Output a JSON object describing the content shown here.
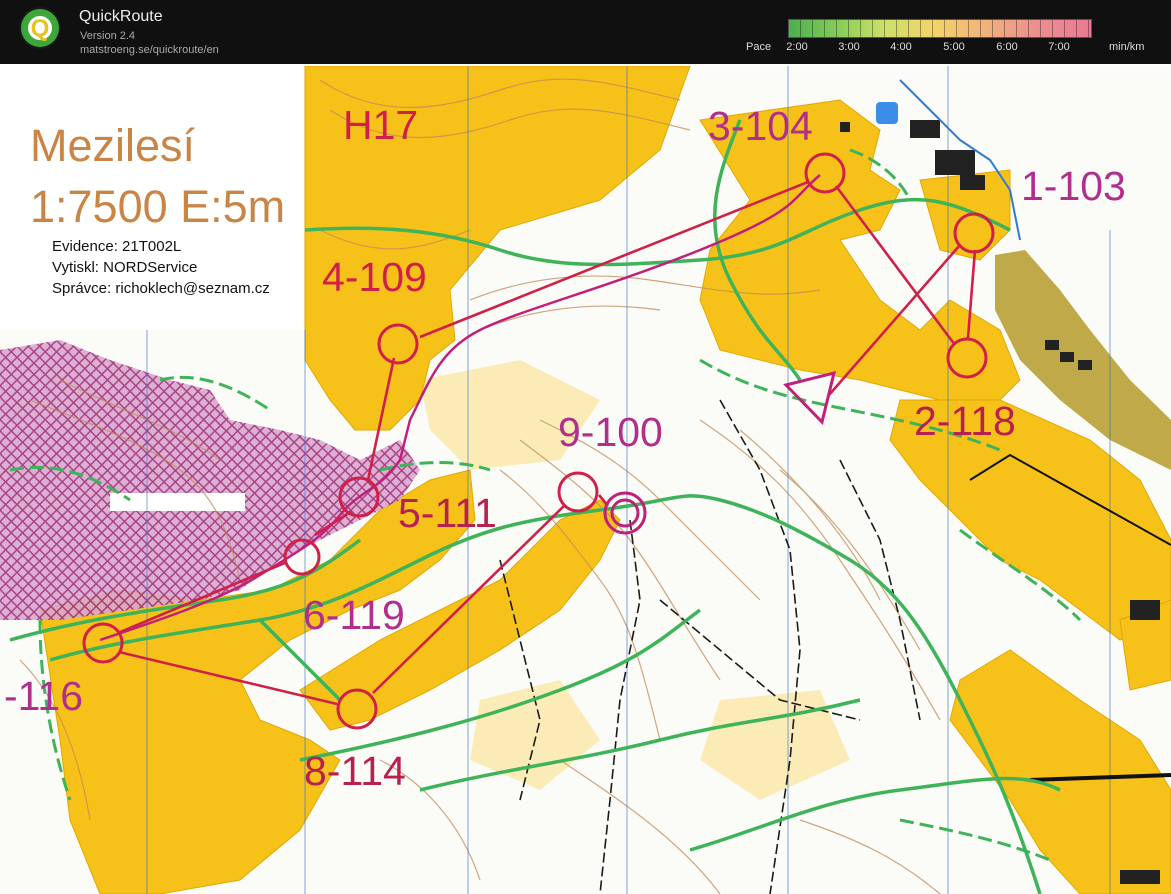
{
  "header": {
    "app_title": "QuickRoute",
    "version": "Version 2.4",
    "url": "matstroeng.se/quickroute/en",
    "logo_letter": "Q",
    "pace_label": "Pace",
    "pace_ticks": [
      "2:00",
      "3:00",
      "4:00",
      "5:00",
      "6:00",
      "7:00"
    ],
    "pace_unit": "min/km"
  },
  "map": {
    "name": "Mezilesí",
    "scale": "1:7500 E:5m",
    "evidence": "Evidence: 21T002L",
    "printed_by": "Vytiskl: NORDService",
    "admin": "Správce: richoklech@seznam.cz",
    "category": "H17"
  },
  "controls": [
    {
      "label": "1-103"
    },
    {
      "label": "2-118"
    },
    {
      "label": "3-104"
    },
    {
      "label": "4-109"
    },
    {
      "label": "5-111"
    },
    {
      "label": "6-119"
    },
    {
      "label": "-116"
    },
    {
      "label": "8-114"
    },
    {
      "label": "9-100"
    }
  ],
  "colors": {
    "course": "#d0204a",
    "control_label": "#b8204f",
    "label_magenta": "#b02e8c",
    "forest_yellow": "#f6c21a",
    "light_yellow": "#fbe79b",
    "path_green": "#3fb35a",
    "route_magenta": "#c0207a",
    "oob_magenta": "#a0307a",
    "contour_brown": "#c08a55"
  }
}
